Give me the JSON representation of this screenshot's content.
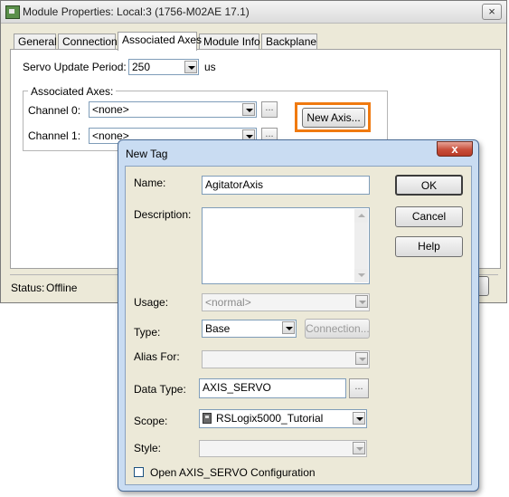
{
  "module_properties": {
    "title": "Module Properties: Local:3 (1756-M02AE 17.1)",
    "close_glyph": "×",
    "tabs": [
      "General",
      "Connection",
      "Associated Axes",
      "Module Info",
      "Backplane"
    ],
    "active_tab": "Associated Axes",
    "servo_update_label": "Servo Update Period:",
    "servo_update_value": "250",
    "servo_update_unit": "us",
    "associated_axes_group": "Associated Axes:",
    "channel0_label": "Channel 0:",
    "channel0_value": "<none>",
    "channel1_label": "Channel 1:",
    "channel1_value": "<none>",
    "ellipsis": "...",
    "new_axis_button": "New Axis...",
    "status_label": "Status:",
    "status_value": "Offline",
    "highlight_color": "#f07a10"
  },
  "new_tag": {
    "title": "New Tag",
    "close_glyph": "x",
    "name_label": "Name:",
    "name_value": "AgitatorAxis",
    "description_label": "Description:",
    "description_value": "",
    "usage_label": "Usage:",
    "usage_value": "<normal>",
    "type_label": "Type:",
    "type_value": "Base",
    "connection_button": "Connection...",
    "alias_label": "Alias For:",
    "alias_value": "",
    "data_type_label": "Data Type:",
    "data_type_value": "AXIS_SERVO",
    "ellipsis": "...",
    "scope_label": "Scope:",
    "scope_value": "RSLogix5000_Tutorial",
    "scope_icon": "project-icon",
    "style_label": "Style:",
    "style_value": "",
    "open_config_label": "Open AXIS_SERVO Configuration",
    "open_config_checked": false,
    "ok_button": "OK",
    "cancel_button": "Cancel",
    "help_button": "Help"
  }
}
